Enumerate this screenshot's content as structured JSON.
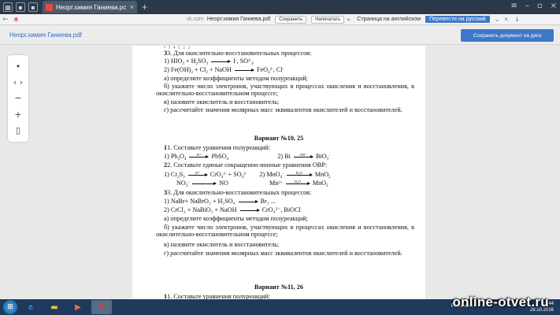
{
  "tabbar": {
    "tab_title": "Неорг.химия Ганиева.pc",
    "tab_close": "×",
    "new_tab": "+"
  },
  "addressbar": {
    "logo": "я",
    "host": "vk.com",
    "page": "Неорг.химия Ганиева.pdf",
    "save_label": "Сохранить",
    "print_label": "Напечатать",
    "translate_prompt": "Страница на английском",
    "translate_button": "Перевести на русский"
  },
  "docbar": {
    "title": "Неорг.химия Ганиева.pdf",
    "save_to_disk": "Сохранить документ на диск"
  },
  "document": {
    "l1": "3. Для окислительно-восстановительных процессов:",
    "l2a": "1) HIO",
    "l2b": " + H",
    "l2c": "SO",
    "l2d": "I",
    "l2e": ", SO",
    "l3a": "2) Fe(OH)",
    "l3b": " + Cl",
    "l3c": " + NaOH",
    "l3d": "FeO",
    "l3e": ", Cl",
    "l4": "а) определите коэффициенты методом полуреакций;",
    "l5": "б) укажите число электронов, участвующих в процессах окисления и восстановления, в окислительно-восстановительном процессе;",
    "l6": "в) назовите окислитель и восстановитель;",
    "l7": "г) рассчитайте значения молярных масс эквивалентов окислителей и восстановителей.",
    "variant10": "Вариант №10, 25",
    "v10_1": "1. Составьте уравнения полуреакций:",
    "v10_eq1a": "1) Pb",
    "v10_eq1b": "O",
    "v10_eq1c": "PbSO",
    "v10_eq2a": "2) Bi",
    "v10_eq2b": "BiO",
    "v10_2": "2. Составьте единые сокращенно-ионные уравнения ОВР:",
    "v10_eq3a": "1) Cr",
    "v10_eq3b": "S",
    "v10_eq3c": "CrO",
    "v10_eq3d": " + SO",
    "v10_eq4a": "2) MnO",
    "v10_eq4b": "MnO",
    "v10_eq5a": "NO",
    "v10_eq5b": "NO",
    "v10_eq6a": "Mn",
    "v10_eq6b": "MnO",
    "v10_3": "3. Для окислительно-восстановительных процессов:",
    "v10_eq7": "1) NaBr+ NaBrO₃ + H₂SO₄",
    "v10_eq7b": "Br₂ ...",
    "v10_eq8": "2) CrCl₃ + NaBiO₃ + NaOH",
    "v10_eq8b": "CrO₄²⁻, BiOCl",
    "v10_4": "а) определите коэффициенты методом полуреакций;",
    "v10_5": "б) укажите число электронов, участвующих в процессах окисления и восстановления, в окислительно-восстановительном процессе;",
    "v10_6": "в) назовите окислитель и восстановитель;",
    "v10_7": "г) рассчитайте значения молярных масс эквивалентов окислителей и восстановителей.",
    "variant11": "Вариант №11, 26",
    "v11_1": "1. Составьте уравнения полуреакций:",
    "arrow_h": "H⁺",
    "arrow_oh": "OH⁻",
    "arrow_h2o": "H₂O"
  },
  "taskbar": {
    "tray_text": "Рабочий с",
    "time": "10:44",
    "date": "28.10.2016"
  },
  "watermark": "online-otvet.ru"
}
